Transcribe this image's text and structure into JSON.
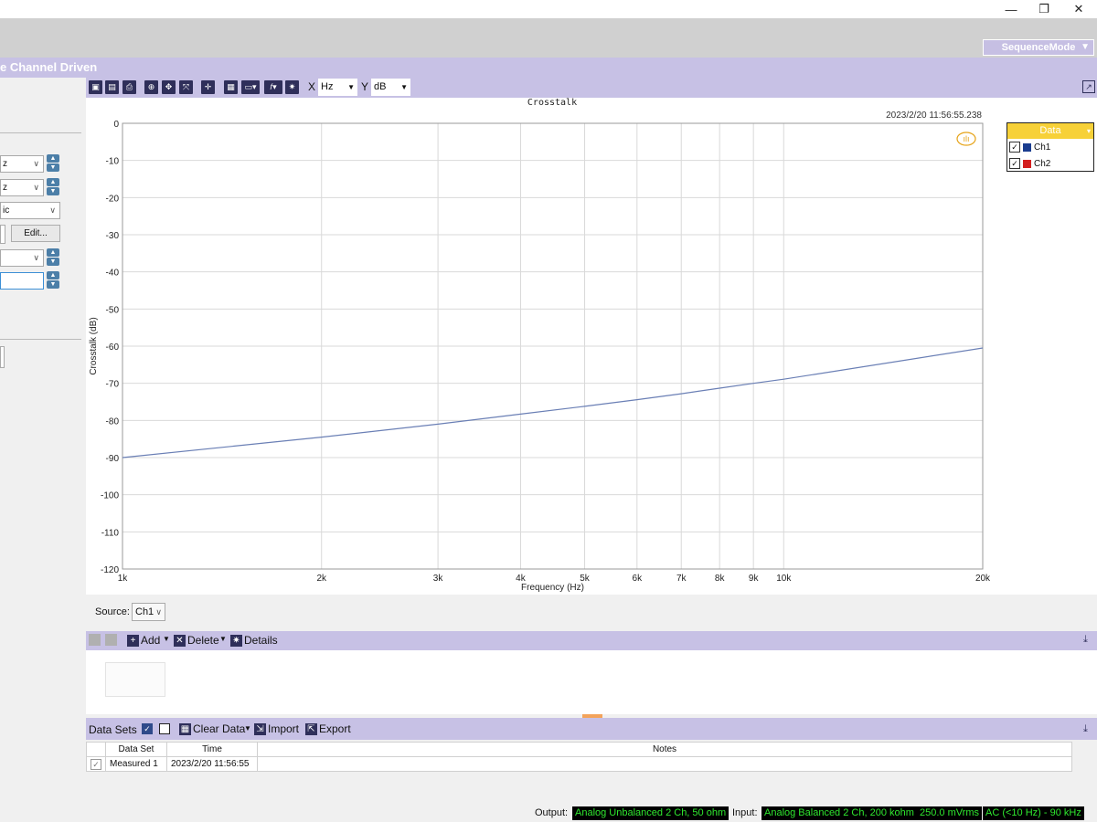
{
  "window": {
    "minimize": "—",
    "restore": "❐",
    "close": "✕"
  },
  "header": {
    "title": "e Channel Driven",
    "sequence_mode": "SequenceMode"
  },
  "left_panel": {
    "selects": [
      "z",
      "z",
      "ic",
      "",
      ""
    ],
    "edit_button": "Edit..."
  },
  "toolbar": {
    "x_label": "X",
    "x_unit": "Hz",
    "y_label": "Y",
    "y_unit": "dB"
  },
  "graph": {
    "title": "Crosstalk",
    "timestamp": "2023/2/20 11:56:55.238",
    "legend": {
      "title": "Data",
      "items": [
        {
          "label": "Ch1",
          "color": "#1a3d8f"
        },
        {
          "label": "Ch2",
          "color": "#d42020"
        }
      ]
    }
  },
  "chart_data": {
    "type": "line",
    "title": "Crosstalk",
    "xlabel": "Frequency (Hz)",
    "ylabel": "Crosstalk (dB)",
    "xscale": "log",
    "xlim": [
      1000,
      20000
    ],
    "ylim": [
      -120,
      0
    ],
    "x_ticks": [
      1000,
      2000,
      3000,
      4000,
      5000,
      6000,
      7000,
      8000,
      9000,
      10000,
      20000
    ],
    "x_tick_labels": [
      "1k",
      "2k",
      "3k",
      "4k",
      "5k",
      "6k",
      "7k",
      "8k",
      "9k",
      "10k",
      "20k"
    ],
    "y_ticks": [
      0,
      -10,
      -20,
      -30,
      -40,
      -50,
      -60,
      -70,
      -80,
      -90,
      -100,
      -110,
      -120
    ],
    "grid": true,
    "legend_position": "top-right outside",
    "series": [
      {
        "name": "Ch1",
        "color": "#6a7fb5",
        "x": [
          1000,
          2000,
          3000,
          4000,
          5000,
          6000,
          7000,
          8000,
          9000,
          10000,
          20000
        ],
        "y": [
          -90,
          -84.5,
          -81,
          -78.3,
          -76.2,
          -74.4,
          -72.8,
          -71.3,
          -70,
          -68.9,
          -60.5
        ]
      }
    ]
  },
  "source": {
    "label": "Source:",
    "value": "Ch1"
  },
  "actions": {
    "add": "Add",
    "delete": "Delete",
    "details": "Details"
  },
  "datasets": {
    "label": "Data Sets",
    "clear": "Clear Data",
    "import": "Import",
    "export": "Export",
    "columns": [
      "Data Set",
      "Time",
      "Notes"
    ],
    "rows": [
      {
        "name": "Measured 1",
        "time": "2023/2/20 11:56:55",
        "notes": ""
      }
    ]
  },
  "status": {
    "output_label": "Output:",
    "output_value": "Analog Unbalanced 2 Ch, 50 ohm",
    "input_label": "Input:",
    "input_value": "Analog Balanced 2 Ch, 200 kohm",
    "level": "250.0 mVrms",
    "coupling": "AC (<10 Hz) - 90 kHz"
  }
}
